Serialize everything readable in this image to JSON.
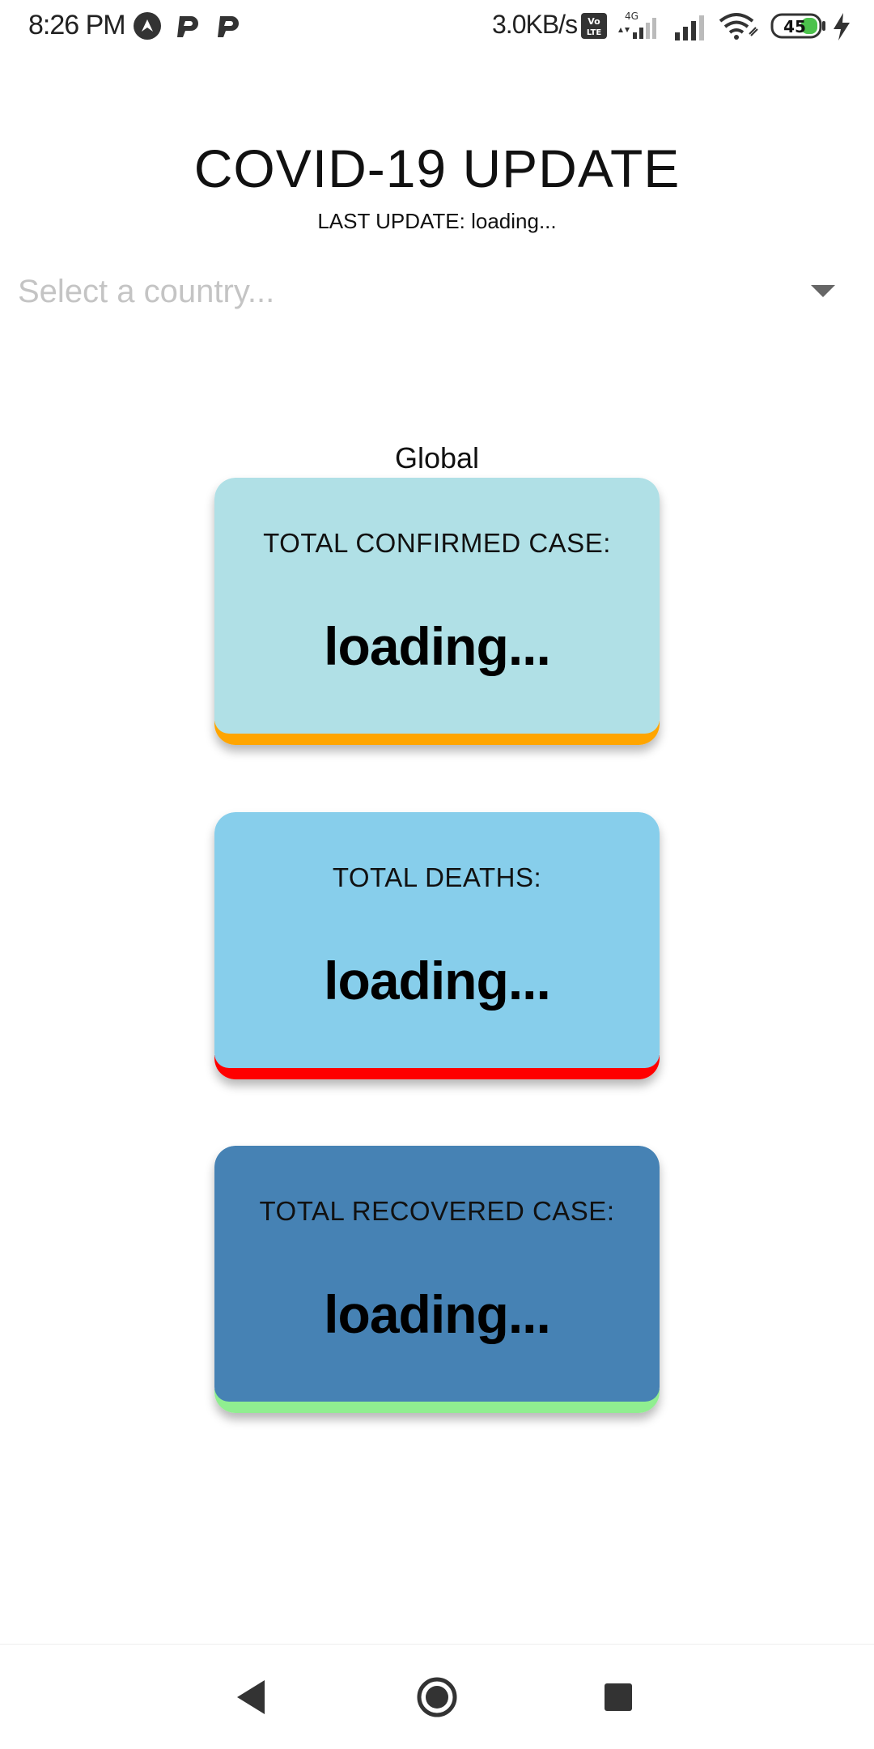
{
  "status_bar": {
    "time": "8:26 PM",
    "network_speed": "3.0KB/s",
    "network_type": "4G",
    "volte": "Vo LTE",
    "battery_level": "45",
    "icons": [
      "android-auto-icon",
      "p-app-icon",
      "p-app-icon",
      "volte-icon",
      "cell-signal-icon",
      "cell-signal-icon",
      "wifi-icon",
      "battery-icon",
      "charging-bolt-icon"
    ]
  },
  "header": {
    "title": "COVID-19 UPDATE",
    "last_update_label": "LAST UPDATE: ",
    "last_update_value": "loading..."
  },
  "country_select": {
    "placeholder": "Select a country...",
    "icon": "chevron-down-icon"
  },
  "region": "Global",
  "cards": [
    {
      "label": "TOTAL CONFIRMED CASE:",
      "value": "loading...",
      "color": "#b0e0e6",
      "accent": "#ffa500"
    },
    {
      "label": "TOTAL DEATHS:",
      "value": "loading...",
      "color": "#87ceeb",
      "accent": "#ff0000"
    },
    {
      "label": "TOTAL RECOVERED CASE:",
      "value": "loading...",
      "color": "#4682b4",
      "accent": "#90ee90"
    }
  ],
  "nav_bar": {
    "buttons": [
      "back-icon",
      "home-icon",
      "recents-icon"
    ]
  }
}
